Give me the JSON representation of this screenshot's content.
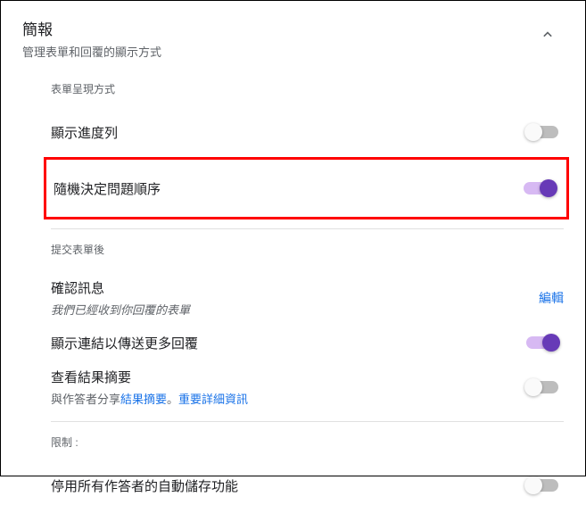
{
  "header": {
    "title": "簡報",
    "subtitle": "管理表單和回覆的顯示方式"
  },
  "group_form": {
    "label": "表單呈現方式",
    "progress": {
      "title": "顯示進度列",
      "on": false
    },
    "shuffle": {
      "title": "隨機決定問題順序",
      "on": true
    }
  },
  "group_submit": {
    "label": "提交表單後",
    "confirm": {
      "title": "確認訊息",
      "desc": "我們已經收到你回覆的表單",
      "edit": "編輯"
    },
    "another": {
      "title": "顯示連結以傳送更多回覆",
      "on": true
    },
    "summary": {
      "title": "查看結果摘要",
      "desc_prefix": "與作答者分享",
      "link1": "結果摘要",
      "period": "。",
      "link2": "重要詳細資訊",
      "on": false
    }
  },
  "group_restrict": {
    "label": "限制 :",
    "autosave": {
      "title": "停用所有作答者的自動儲存功能",
      "on": false
    }
  }
}
